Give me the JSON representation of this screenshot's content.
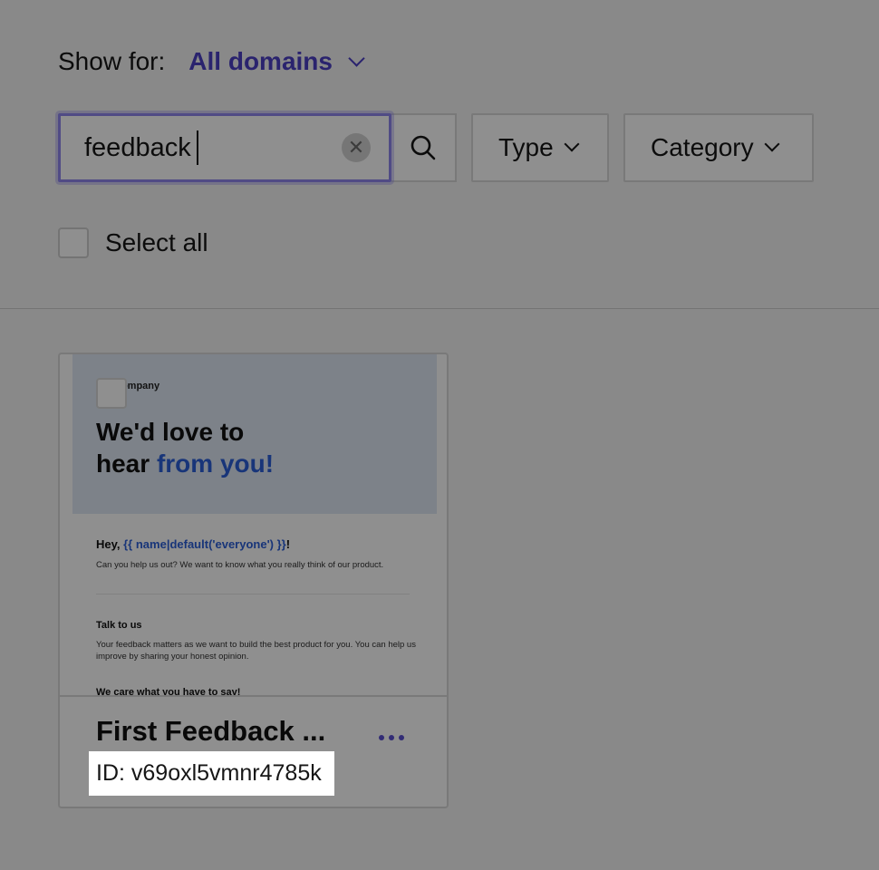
{
  "filters": {
    "show_for_label": "Show for:",
    "domain_value": "All domains",
    "search_value": "feedback",
    "type_label": "Type",
    "category_label": "Category",
    "select_all_label": "Select all"
  },
  "template_card": {
    "preview": {
      "company": "Company",
      "headline_part1": "We'd love to",
      "headline_part2": "hear",
      "headline_highlight": "from you!",
      "greeting_prefix": "Hey,",
      "greeting_var": "{{ name|default('everyone') }}",
      "greeting_suffix": "!",
      "intro": "Can you help us out? We want to know what you really think of our product.",
      "talk_heading": "Talk to us",
      "talk_body": "Your feedback matters as we want to build the best product for you. You can help us improve by sharing your honest opinion.",
      "care_heading": "We care what you have to say!"
    },
    "title": "First Feedback ...",
    "id_text": "ID: v69oxl5vmnr4785k"
  },
  "colors": {
    "accent": "#4b3fc4",
    "focus_border": "#8f87ee",
    "highlight_blue": "#2c5fd8"
  },
  "icons": {
    "search": "search-icon",
    "clear": "clear-icon",
    "chevron": "chevron-down-icon",
    "more": "more-horizontal-icon"
  }
}
